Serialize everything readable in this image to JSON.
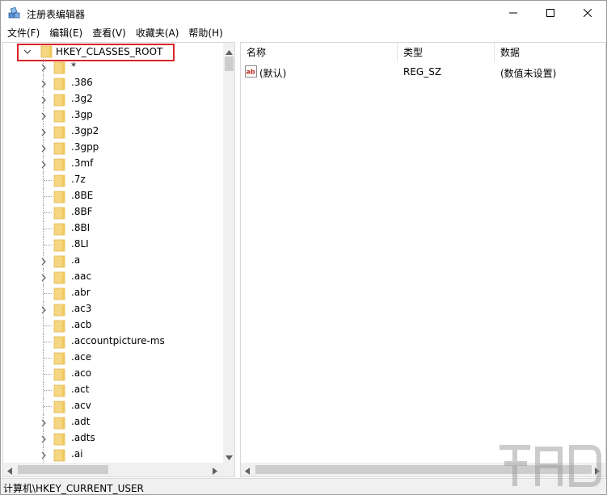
{
  "window": {
    "title": "注册表编辑器"
  },
  "menu": [
    "文件(F)",
    "编辑(E)",
    "查看(V)",
    "收藏夹(A)",
    "帮助(H)"
  ],
  "tree": {
    "root_label": "HKEY_CLASSES_ROOT",
    "items": [
      {
        "label": "*",
        "expandable": true
      },
      {
        "label": ".386",
        "expandable": true
      },
      {
        "label": ".3g2",
        "expandable": true
      },
      {
        "label": ".3gp",
        "expandable": true
      },
      {
        "label": ".3gp2",
        "expandable": true
      },
      {
        "label": ".3gpp",
        "expandable": true
      },
      {
        "label": ".3mf",
        "expandable": true
      },
      {
        "label": ".7z",
        "expandable": false
      },
      {
        "label": ".8BE",
        "expandable": false
      },
      {
        "label": ".8BF",
        "expandable": false
      },
      {
        "label": ".8BI",
        "expandable": false
      },
      {
        "label": ".8LI",
        "expandable": false
      },
      {
        "label": ".a",
        "expandable": true
      },
      {
        "label": ".aac",
        "expandable": true
      },
      {
        "label": ".abr",
        "expandable": false
      },
      {
        "label": ".ac3",
        "expandable": true
      },
      {
        "label": ".acb",
        "expandable": false
      },
      {
        "label": ".accountpicture-ms",
        "expandable": false
      },
      {
        "label": ".ace",
        "expandable": false
      },
      {
        "label": ".aco",
        "expandable": false
      },
      {
        "label": ".act",
        "expandable": false
      },
      {
        "label": ".acv",
        "expandable": false
      },
      {
        "label": ".adt",
        "expandable": true
      },
      {
        "label": ".adts",
        "expandable": true
      },
      {
        "label": ".ai",
        "expandable": true
      }
    ]
  },
  "list": {
    "columns": [
      "名称",
      "类型",
      "数据"
    ],
    "rows": [
      {
        "name": "(默认)",
        "type": "REG_SZ",
        "data": "(数值未设置)"
      }
    ]
  },
  "status": {
    "path": "计算机\\HKEY_CURRENT_USER"
  },
  "colors": {
    "highlight_box": "#d9262a",
    "folder": "#f5d682",
    "folder_edge": "#e2b84f"
  }
}
